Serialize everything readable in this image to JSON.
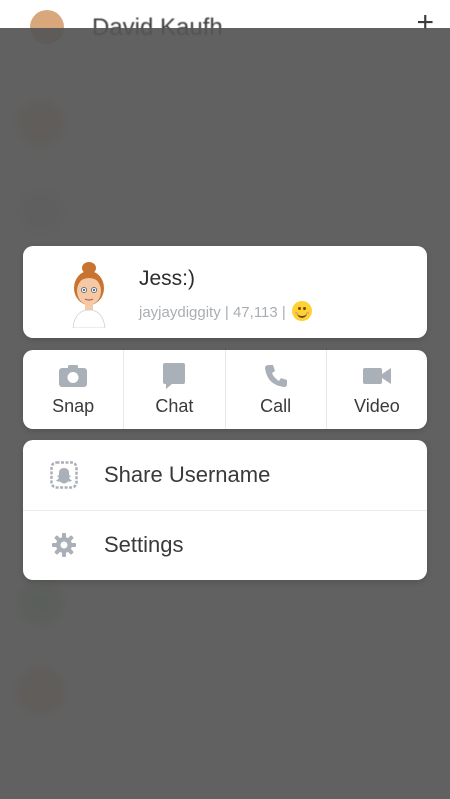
{
  "background": {
    "header_title": "David Kaufh",
    "plus_label": "+"
  },
  "profile": {
    "display_name": "Jess:)",
    "username": "jayjaydiggity",
    "score": "47,113",
    "separator": "|",
    "emoji": "smiling-face"
  },
  "actions": [
    {
      "label": "Snap",
      "icon": "camera-icon"
    },
    {
      "label": "Chat",
      "icon": "chat-bubble-icon"
    },
    {
      "label": "Call",
      "icon": "phone-icon"
    },
    {
      "label": "Video",
      "icon": "video-camera-icon"
    }
  ],
  "menu": [
    {
      "label": "Share Username",
      "icon": "snapcode-icon"
    },
    {
      "label": "Settings",
      "icon": "gear-icon"
    }
  ],
  "colors": {
    "overlay": "#555555",
    "icon_gray": "#aab0b8",
    "text_dark": "#3a3a3a",
    "meta_gray": "#a9aeb4"
  }
}
